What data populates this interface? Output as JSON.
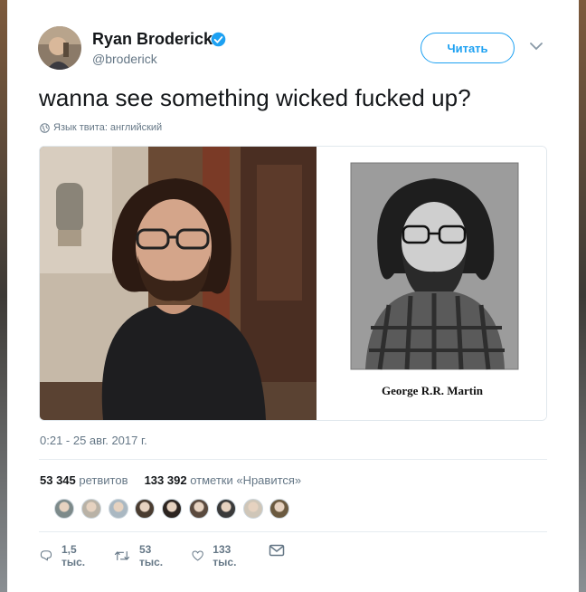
{
  "tweet": {
    "author_name": "Ryan Broderick",
    "handle": "@broderick",
    "follow_label": "Читать",
    "text": "wanna see something wicked fucked up?",
    "language_note": "Язык твита: английский",
    "image_caption": "George R.R. Martin",
    "timestamp": "0:21 - 25 авг. 2017 г.",
    "retweets_count": "53 345",
    "retweets_label": "ретвитов",
    "likes_count": "133 392",
    "likes_label": "отметки «Нравится»",
    "liker_avatars": [
      "#7d8a8a",
      "#b9b2a6",
      "#aab8c2",
      "#4a3c30",
      "#2c2420",
      "#5a4a3e",
      "#3a3a3a",
      "#cfc6b8",
      "#6b5a40"
    ]
  },
  "actions": {
    "reply_count": "1,5 тыс.",
    "retweet_count": "53 тыс.",
    "like_count": "133 тыс."
  },
  "colors": {
    "accent": "#1da1f2",
    "verified": "#1da1f2",
    "text": "#14171a",
    "secondary": "#657786"
  }
}
